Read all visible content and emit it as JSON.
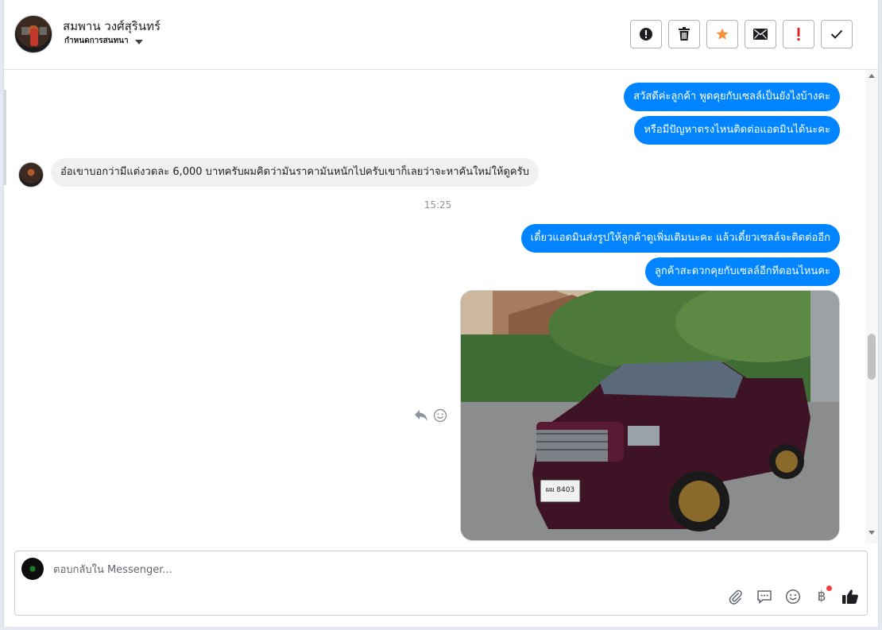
{
  "header": {
    "contact_name": "สมพาน วงศ์สุรินทร์",
    "label_dropdown": "กำหนดการสนทนา",
    "actions": [
      {
        "name": "mark-spam-button",
        "icon": "alert-circle-icon"
      },
      {
        "name": "delete-button",
        "icon": "trash-icon"
      },
      {
        "name": "star-button",
        "icon": "star-icon",
        "color": "#f7923a"
      },
      {
        "name": "mark-unread-button",
        "icon": "envelope-icon"
      },
      {
        "name": "follow-up-button",
        "icon": "exclamation-icon",
        "color": "#e02424"
      },
      {
        "name": "mark-done-button",
        "icon": "check-icon"
      }
    ]
  },
  "messages": {
    "out_1": "สวัสดีค่ะลูกค้า พูดคุยกับเซลล์เป็นยังไงบ้างคะ",
    "out_2": "หรือมีปัญหาตรงไหนติดต่อแอดมินได้นะคะ",
    "in_1": "อ๋อเขาบอกว่ามีแต่งวดละ 6,000 บาทครับผมคิดว่ามันราคามันหนักไปครับเขาก็เลยว่าจะหาคันใหม่ให้ดูครับ",
    "timestamp": "15:25",
    "out_3": "เดี๋ยวแอดมินส่งรูปให้ลูกค้าดูเพิ่มเติมนะคะ แล้วเดี๋ยวเซลล์จะติดต่ออีก",
    "out_4": "ลูกค้าสะดวกคุยกับเซลล์อีกทีตอนไหนคะ",
    "photo_plate": "ผผ 8403"
  },
  "composer": {
    "placeholder": "ตอบกลับใน Messenger...",
    "baht_symbol": "฿"
  },
  "colors": {
    "outgoing_bubble": "#0084ff",
    "incoming_bubble": "#f0f0f0",
    "star": "#f7923a",
    "follow_up": "#e02424",
    "notification_dot": "#fa3e3e"
  }
}
